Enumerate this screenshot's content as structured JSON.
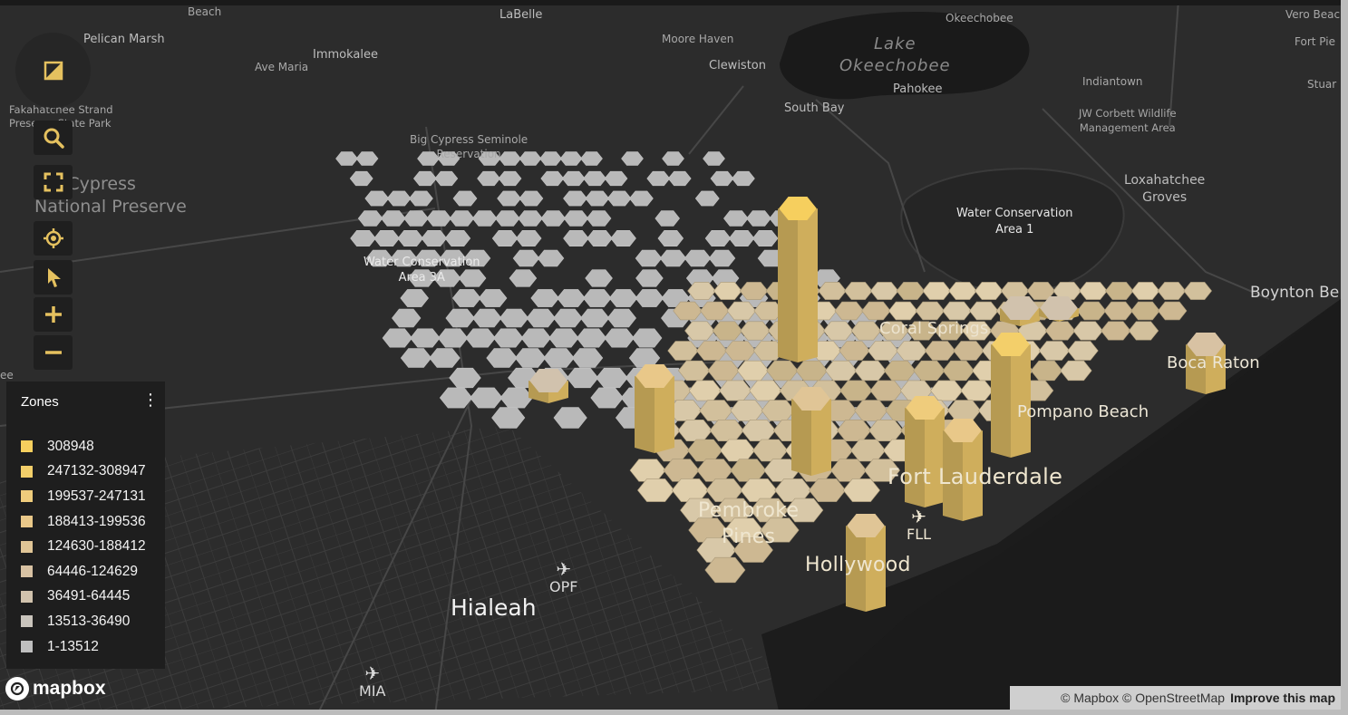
{
  "places": [
    {
      "id": "beach",
      "text": "Beach"
    },
    {
      "id": "labelle",
      "text": "LaBelle"
    },
    {
      "id": "okeechobee",
      "text": "Okeechobee"
    },
    {
      "id": "vero",
      "text": "Vero Beac"
    },
    {
      "id": "pelican",
      "text": "Pelican Marsh"
    },
    {
      "id": "fortpie",
      "text": "Fort Pie"
    },
    {
      "id": "moore",
      "text": "Moore Haven"
    },
    {
      "id": "immokalee",
      "text": "Immokalee"
    },
    {
      "id": "avemaria",
      "text": "Ave Maria"
    },
    {
      "id": "clewiston",
      "text": "Clewiston"
    },
    {
      "id": "pahokee",
      "text": "Pahokee"
    },
    {
      "id": "indiantown",
      "text": "Indiantown"
    },
    {
      "id": "stuart",
      "text": "Stuar"
    },
    {
      "id": "fakahatchee",
      "text": "Fakahatchee Strand\nPreserve State Park"
    },
    {
      "id": "southbay",
      "text": "South Bay"
    },
    {
      "id": "jwcorbett",
      "text": "JW Corbett Wildlife\nManagement Area"
    },
    {
      "id": "bigcypressres",
      "text": "Big Cypress Seminole\nReservation"
    },
    {
      "id": "bigcypressnp",
      "text": "Big Cypress\nNational Preserve"
    },
    {
      "id": "loxahatchee",
      "text": "Loxahatchee\nGroves"
    },
    {
      "id": "wca1",
      "text": "Water Conservation\nArea 1"
    },
    {
      "id": "wca3a",
      "text": "Water Conservation\nArea 3A"
    },
    {
      "id": "boynton",
      "text": "Boynton Be"
    },
    {
      "id": "coralsprings",
      "text": "Coral Springs"
    },
    {
      "id": "bocaraton",
      "text": "Boca Raton"
    },
    {
      "id": "pompano",
      "text": "Pompano Beach"
    },
    {
      "id": "fortlauderdale",
      "text": "Fort Lauderdale"
    },
    {
      "id": "pembroke",
      "text": "Pembroke\nPines"
    },
    {
      "id": "hollywood",
      "text": "Hollywood"
    },
    {
      "id": "hialeah",
      "text": "Hialeah"
    },
    {
      "id": "ee",
      "text": "ee"
    }
  ],
  "lake": {
    "text": "Lake\nOkeechobee"
  },
  "airports": [
    {
      "id": "opf",
      "code": "OPF",
      "icon": "airplane-icon"
    },
    {
      "id": "fll",
      "code": "FLL",
      "icon": "airplane-icon"
    },
    {
      "id": "mia",
      "code": "MIA",
      "icon": "airplane-icon"
    }
  ],
  "controls": [
    {
      "id": "brand",
      "icon": "slashed-square-icon"
    },
    {
      "id": "search",
      "icon": "search-icon"
    },
    {
      "id": "fullscreen",
      "icon": "fullscreen-icon"
    },
    {
      "id": "locate",
      "icon": "locate-icon"
    },
    {
      "id": "select",
      "icon": "cursor-icon"
    },
    {
      "id": "zoom_in",
      "icon": "plus-icon"
    },
    {
      "id": "zoom_out",
      "icon": "minus-icon"
    }
  ],
  "legend": {
    "title": "Zones",
    "menu_icon": "kebab-menu-icon",
    "items": [
      {
        "label": "308948",
        "color": "#f6cf5e"
      },
      {
        "label": "247132-308947",
        "color": "#f3cf6a"
      },
      {
        "label": "199537-247131",
        "color": "#efcc7c"
      },
      {
        "label": "188413-199536",
        "color": "#e9c889"
      },
      {
        "label": "124630-188412",
        "color": "#e0c596"
      },
      {
        "label": "64446-124629",
        "color": "#d8c2a3"
      },
      {
        "label": "36491-64445",
        "color": "#d1c2ad"
      },
      {
        "label": "13513-36490",
        "color": "#c9c4bc"
      },
      {
        "label": "1-13512",
        "color": "#bfbfbf"
      }
    ]
  },
  "branding": {
    "logo_text": "mapbox"
  },
  "attribution": {
    "mapbox": "© Mapbox",
    "osm": "© OpenStreetMap",
    "improve": "Improve this map"
  },
  "colors": {
    "background": "#2b2b2b",
    "water": "#1a1a1a",
    "accent": "#e5c15f",
    "low_hex": "#bdbdbd"
  }
}
